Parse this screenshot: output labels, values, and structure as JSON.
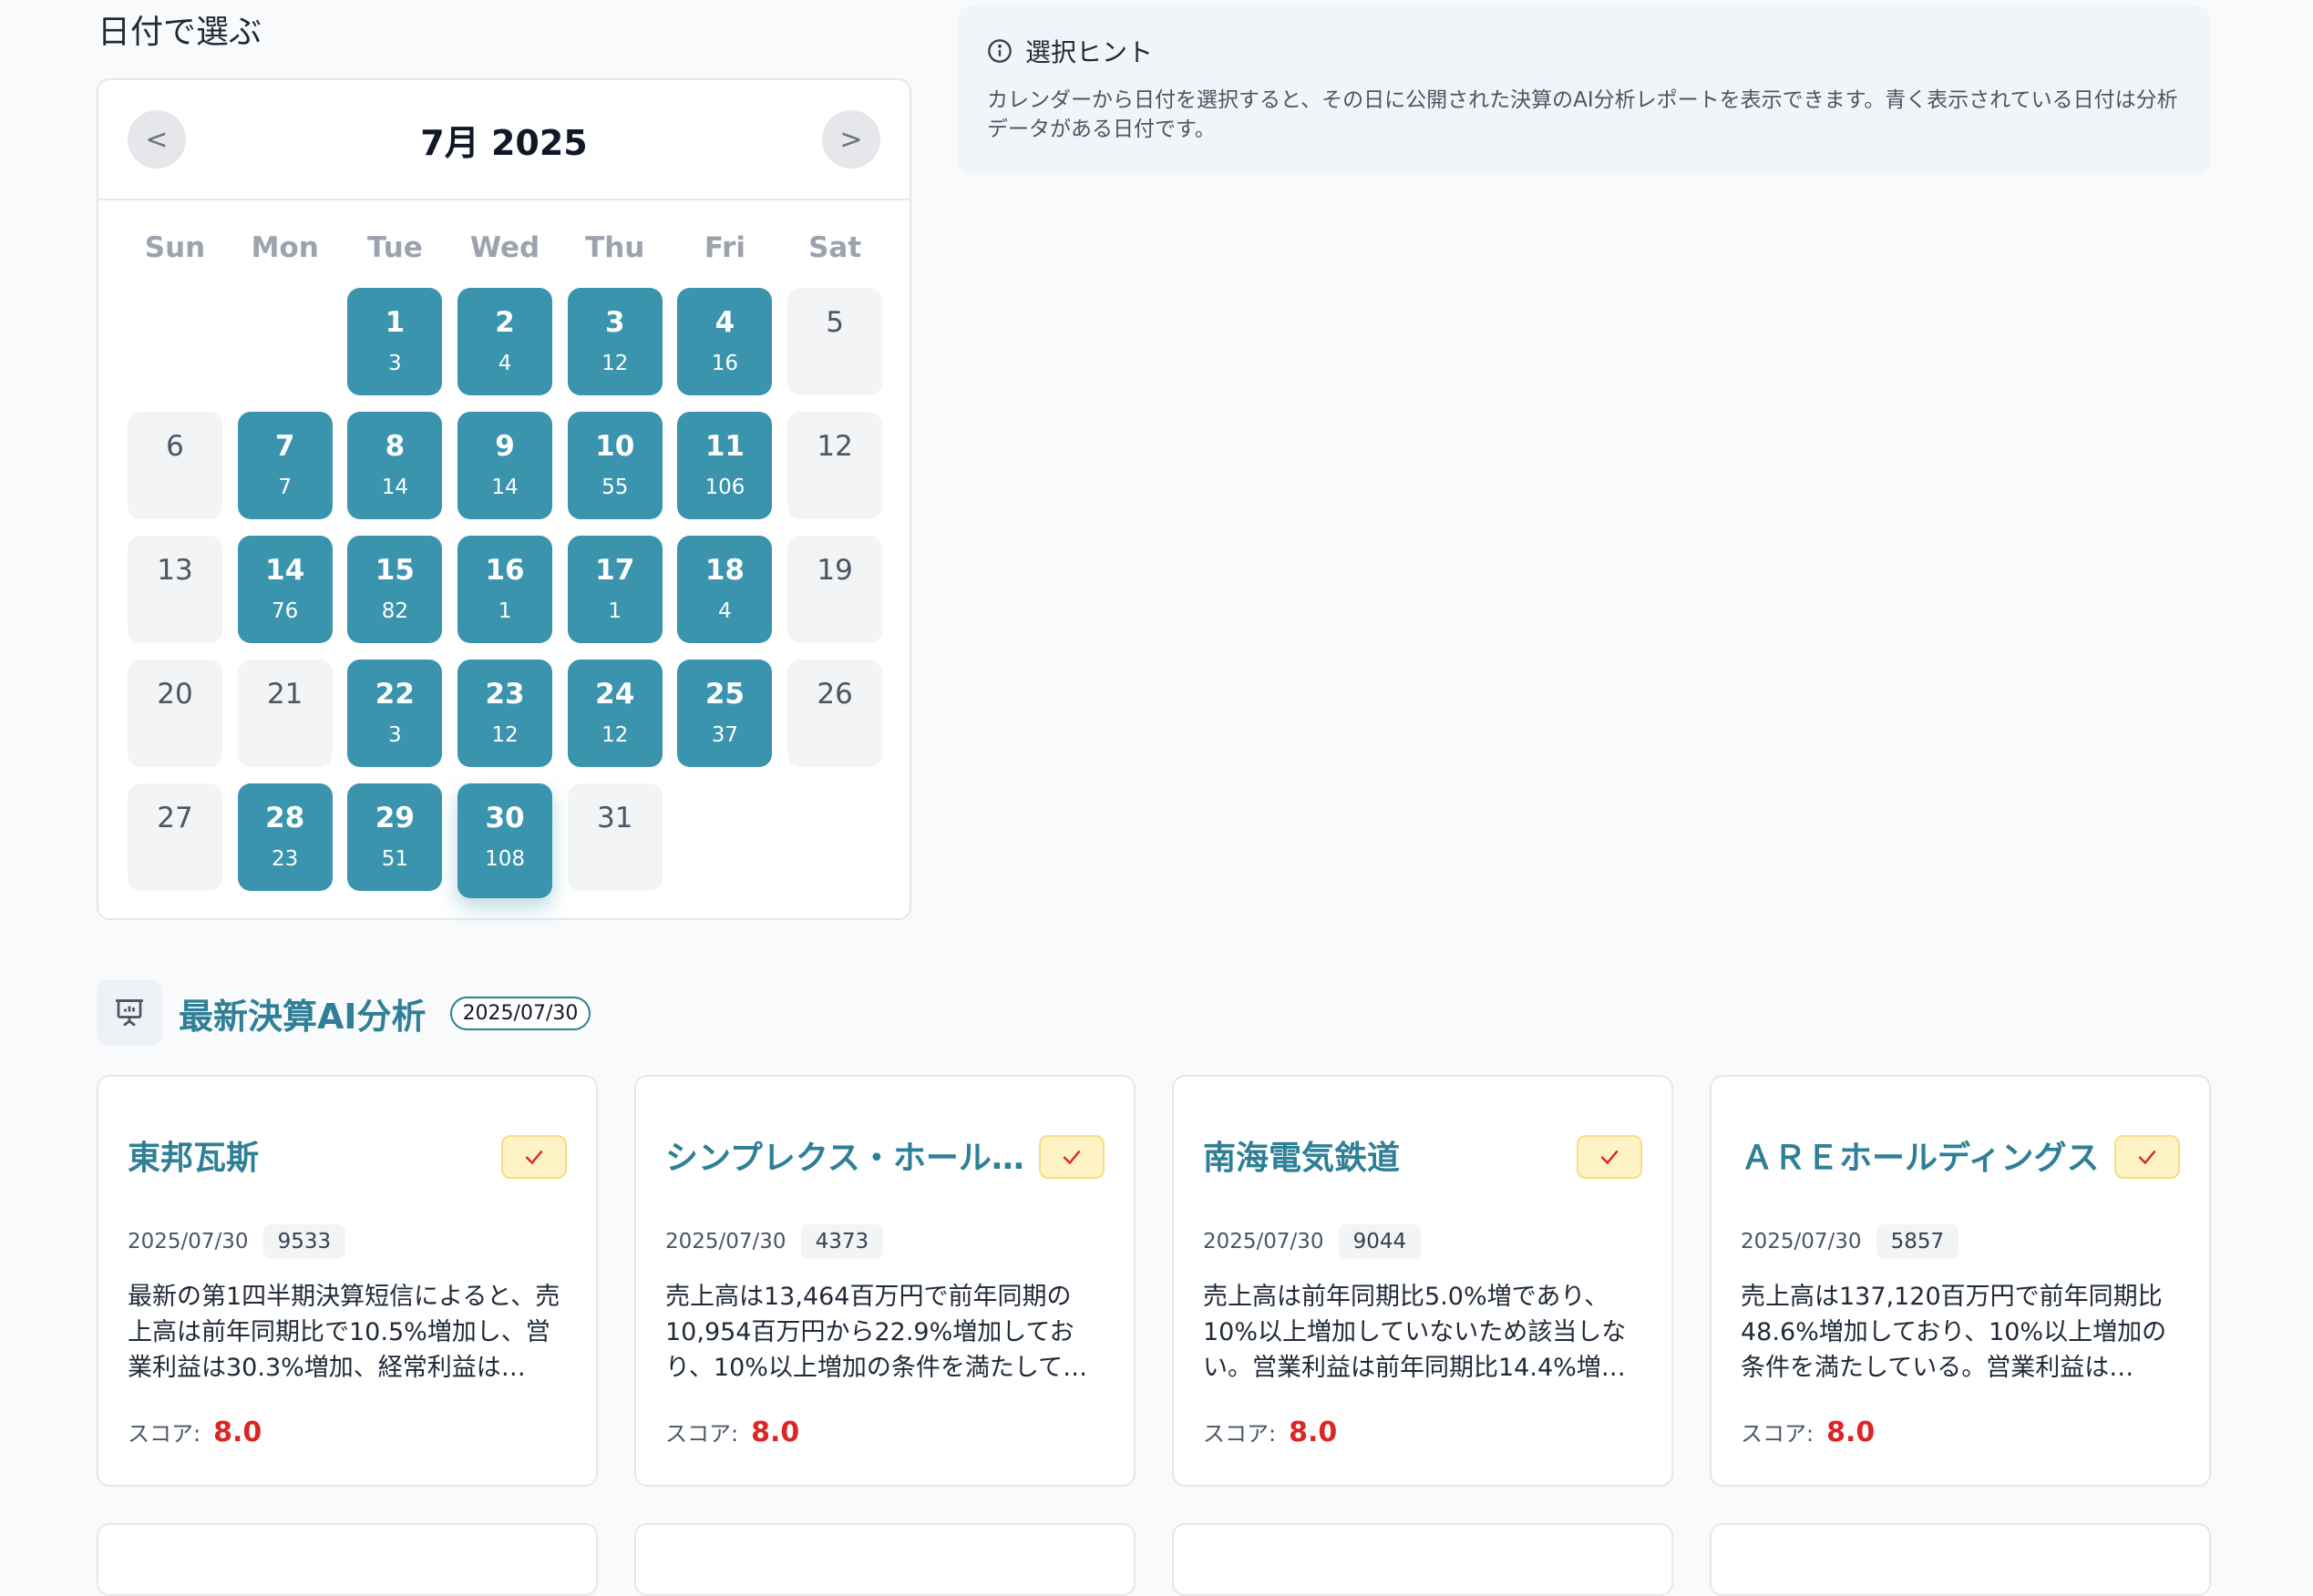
{
  "calendar": {
    "section_title": "日付で選ぶ",
    "month": "7月 2025",
    "prev": "<",
    "next": ">",
    "weekdays": [
      "Sun",
      "Mon",
      "Tue",
      "Wed",
      "Thu",
      "Fri",
      "Sat"
    ],
    "leading_blanks": 2,
    "days": [
      {
        "d": "1",
        "count": "3"
      },
      {
        "d": "2",
        "count": "4"
      },
      {
        "d": "3",
        "count": "12"
      },
      {
        "d": "4",
        "count": "16"
      },
      {
        "d": "5",
        "count": null
      },
      {
        "d": "6",
        "count": null
      },
      {
        "d": "7",
        "count": "7"
      },
      {
        "d": "8",
        "count": "14"
      },
      {
        "d": "9",
        "count": "14"
      },
      {
        "d": "10",
        "count": "55"
      },
      {
        "d": "11",
        "count": "106"
      },
      {
        "d": "12",
        "count": null
      },
      {
        "d": "13",
        "count": null
      },
      {
        "d": "14",
        "count": "76"
      },
      {
        "d": "15",
        "count": "82"
      },
      {
        "d": "16",
        "count": "1"
      },
      {
        "d": "17",
        "count": "1"
      },
      {
        "d": "18",
        "count": "4"
      },
      {
        "d": "19",
        "count": null
      },
      {
        "d": "20",
        "count": null
      },
      {
        "d": "21",
        "count": null
      },
      {
        "d": "22",
        "count": "3"
      },
      {
        "d": "23",
        "count": "12"
      },
      {
        "d": "24",
        "count": "12"
      },
      {
        "d": "25",
        "count": "37"
      },
      {
        "d": "26",
        "count": null
      },
      {
        "d": "27",
        "count": null
      },
      {
        "d": "28",
        "count": "23"
      },
      {
        "d": "29",
        "count": "51"
      },
      {
        "d": "30",
        "count": "108",
        "selected": true
      },
      {
        "d": "31",
        "count": null
      }
    ]
  },
  "hint": {
    "title": "選択ヒント",
    "text": "カレンダーから日付を選択すると、その日に公開された決算のAI分析レポートを表示できます。青く表示されている日付は分析データがある日付です。"
  },
  "latest": {
    "title": "最新決算AI分析",
    "date": "2025/07/30",
    "score_label": "スコア:",
    "cards": [
      {
        "name": "東邦瓦斯",
        "date": "2025/07/30",
        "code": "9533",
        "summary": "最新の第1四半期決算短信によると、売上高は前年同期比で10.5%増加し、営業利益は30.3%増加、経常利益は…",
        "score": "8.0"
      },
      {
        "name": "シンプレクス・ホール…",
        "date": "2025/07/30",
        "code": "4373",
        "summary": "売上高は13,464百万円で前年同期の10,954百万円から22.9%増加しており、10%以上増加の条件を満たして…",
        "score": "8.0"
      },
      {
        "name": "南海電気鉄道",
        "date": "2025/07/30",
        "code": "9044",
        "summary": "売上高は前年同期比5.0%増であり、10%以上増加していないため該当しない。営業利益は前年同期比14.4%増…",
        "score": "8.0"
      },
      {
        "name": "ＡＲＥホールディングス",
        "date": "2025/07/30",
        "code": "5857",
        "summary": "売上高は137,120百万円で前年同期比48.6%増加しており、10%以上増加の条件を満たしている。営業利益は…",
        "score": "8.0"
      }
    ]
  },
  "colors": {
    "accent": "#3a94ad",
    "title": "#2f7f97",
    "score": "#dc2626",
    "badge": "#fdf3c4"
  }
}
